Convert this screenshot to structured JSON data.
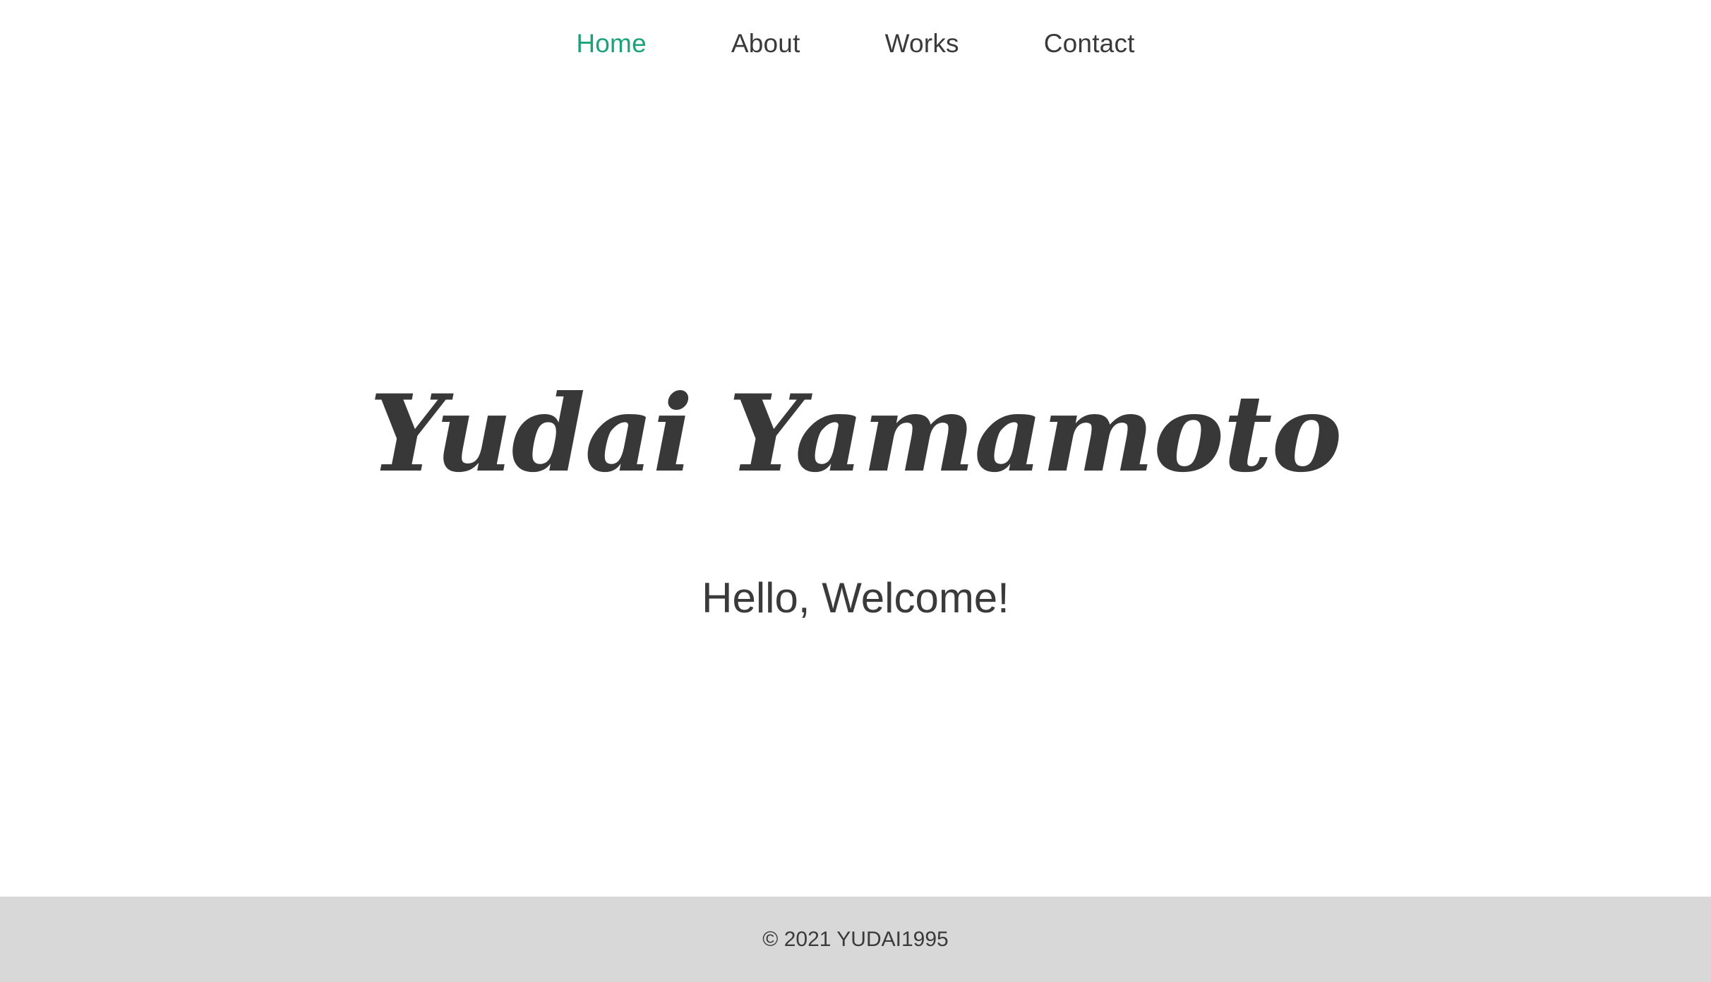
{
  "nav": {
    "items": [
      {
        "label": "Home"
      },
      {
        "label": "About"
      },
      {
        "label": "Works"
      },
      {
        "label": "Contact"
      }
    ],
    "active_color": "#1aa37a",
    "text_color": "#3a3a3a"
  },
  "hero": {
    "title": "Yudai Yamamoto",
    "subtitle": "Hello, Welcome!"
  },
  "footer": {
    "copyright": "© 2021 YUDAI1995",
    "background_color": "#d8d8d8"
  }
}
